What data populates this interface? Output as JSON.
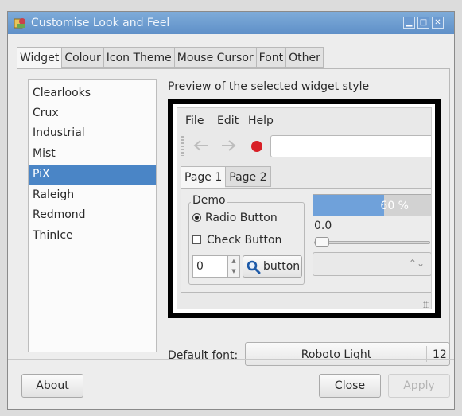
{
  "window": {
    "title": "Customise Look and Feel",
    "controls": [
      "minimize-icon",
      "maximize-icon",
      "close-icon"
    ]
  },
  "tabs": [
    {
      "label": "Widget",
      "active": true
    },
    {
      "label": "Colour"
    },
    {
      "label": "Icon Theme"
    },
    {
      "label": "Mouse Cursor"
    },
    {
      "label": "Font"
    },
    {
      "label": "Other"
    }
  ],
  "widget_tab": {
    "themes": [
      "Clearlooks",
      "Crux",
      "Industrial",
      "Mist",
      "PiX",
      "Raleigh",
      "Redmond",
      "ThinIce"
    ],
    "selected_theme": "PiX",
    "preview_label": "Preview of the selected widget style",
    "preview": {
      "menus": [
        "File",
        "Edit",
        "Help"
      ],
      "tabs": [
        "Page 1",
        "Page 2"
      ],
      "demo_label": "Demo",
      "radio_label": "Radio Button",
      "check_label": "Check Button",
      "spin_value": "0",
      "button_label": "button",
      "progress_text": "60 %",
      "progress_fraction": 0.6,
      "scale_value": "0.0"
    },
    "default_font_label": "Default font:",
    "font_name": "Roboto Light",
    "font_size": "12"
  },
  "footer": {
    "about_label": "About",
    "close_label": "Close",
    "apply_label": "Apply"
  },
  "colors": {
    "selection": "#4a85c6",
    "titlebar": "#6b9bd0",
    "record": "#d81f26"
  }
}
